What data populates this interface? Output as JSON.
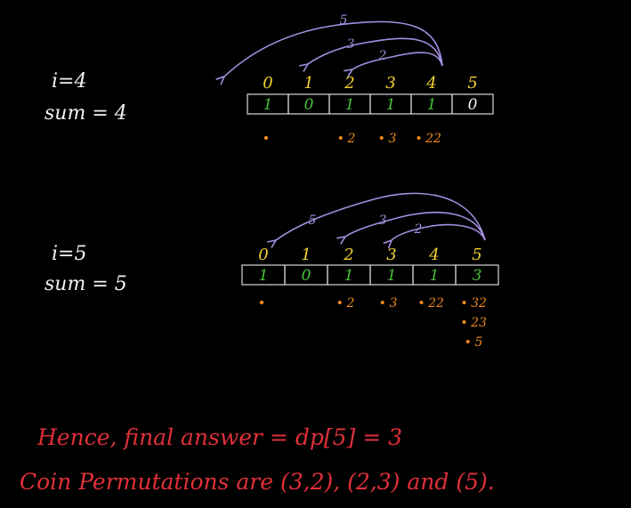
{
  "step1": {
    "i_label": "i=4",
    "sum_label": "sum = 4",
    "indices": [
      "0",
      "1",
      "2",
      "3",
      "4",
      "5"
    ],
    "cells": [
      "1",
      "0",
      "1",
      "1",
      "1",
      "0"
    ],
    "arc_labels": [
      "5",
      "3",
      "2"
    ],
    "perms": [
      {
        "col": 0,
        "text": ""
      },
      {
        "col": 2,
        "text": "2"
      },
      {
        "col": 3,
        "text": "3"
      },
      {
        "col": 4,
        "text": "22"
      }
    ]
  },
  "step2": {
    "i_label": "i=5",
    "sum_label": "sum = 5",
    "indices": [
      "0",
      "1",
      "2",
      "3",
      "4",
      "5"
    ],
    "cells": [
      "1",
      "0",
      "1",
      "1",
      "1",
      "3"
    ],
    "arc_labels": [
      "5",
      "3",
      "2"
    ],
    "perms": [
      {
        "col": 0,
        "text": ""
      },
      {
        "col": 2,
        "text": "2"
      },
      {
        "col": 3,
        "text": "3"
      },
      {
        "col": 4,
        "text": "22"
      },
      {
        "col": 5,
        "text": "32"
      },
      {
        "col": 5,
        "text": "23"
      },
      {
        "col": 5,
        "text": "5"
      }
    ]
  },
  "conclusion": {
    "line1": "Hence, final answer = dp[5] = 3",
    "line2": "Coin Permutations are (3,2), (2,3) and (5)."
  },
  "colors": {
    "background": "#000000",
    "index": "#f2d230",
    "cell_value": "#48c23a",
    "permutation": "#f08a1c",
    "arrow": "#a48fe0",
    "conclusion": "#e0303a"
  }
}
